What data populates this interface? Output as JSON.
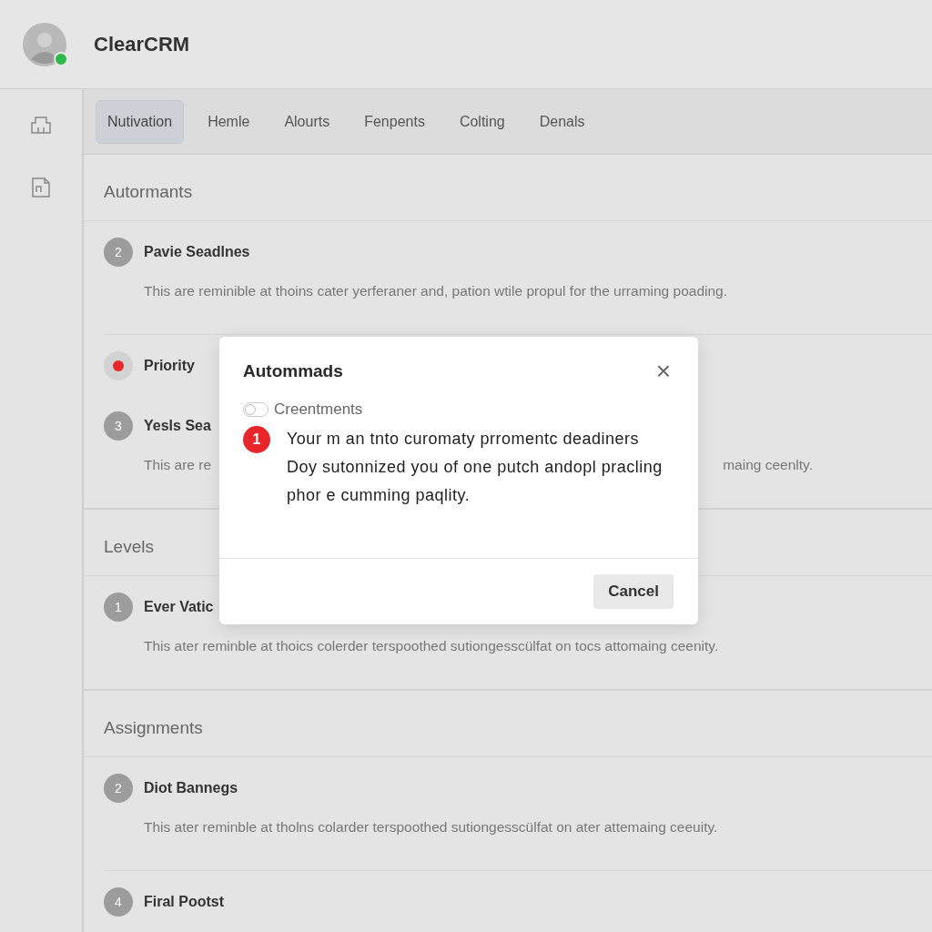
{
  "header": {
    "app_name": "ClearCRM"
  },
  "tabs": [
    {
      "label": "Nutivation",
      "selected": true
    },
    {
      "label": "Hemle",
      "selected": false
    },
    {
      "label": "Alourts",
      "selected": false
    },
    {
      "label": "Fenpents",
      "selected": false
    },
    {
      "label": "Colting",
      "selected": false
    },
    {
      "label": "Denals",
      "selected": false
    }
  ],
  "sections": [
    {
      "title": "Autormants",
      "items": [
        {
          "kind": "number",
          "badge": "2",
          "title": "Pavie Seadlnes",
          "description": [
            "This are reminible at thoins cater yerferaner and, pation wtile propul for the urraming poading."
          ]
        },
        {
          "kind": "dot",
          "color": "#e8262b",
          "title": "Priority"
        },
        {
          "kind": "number",
          "badge": "3",
          "title": "Yesls Sea",
          "description": [
            "This are re",
            "maing ceenlty."
          ]
        }
      ]
    },
    {
      "title": "Levels",
      "items": [
        {
          "kind": "number",
          "badge": "1",
          "title": "Ever Vatic",
          "description": [
            "This ater reminble at thoics colerder terspoothed sutiongesscülfat on tocs attomaing ceenity."
          ]
        }
      ]
    },
    {
      "title": "Assignments",
      "items": [
        {
          "kind": "number",
          "badge": "2",
          "title": "Diot Bannegs",
          "description": [
            "This ater reminble at tholns colarder terspoothed sutiongesscülfat on ater attemaing ceeuity."
          ]
        },
        {
          "kind": "number",
          "badge": "4",
          "title": "Firal Pootst"
        }
      ]
    }
  ],
  "dialog": {
    "title": "Autommads",
    "close": "×",
    "toggle": {
      "label": "Creentments",
      "on": false
    },
    "badge": "1",
    "message": "Your m an tnto curomaty prromentc deadiners Doy sutonnized you of one putch andopl pracling phor e cumming paqlity.",
    "buttons": [
      "Cancel"
    ]
  }
}
